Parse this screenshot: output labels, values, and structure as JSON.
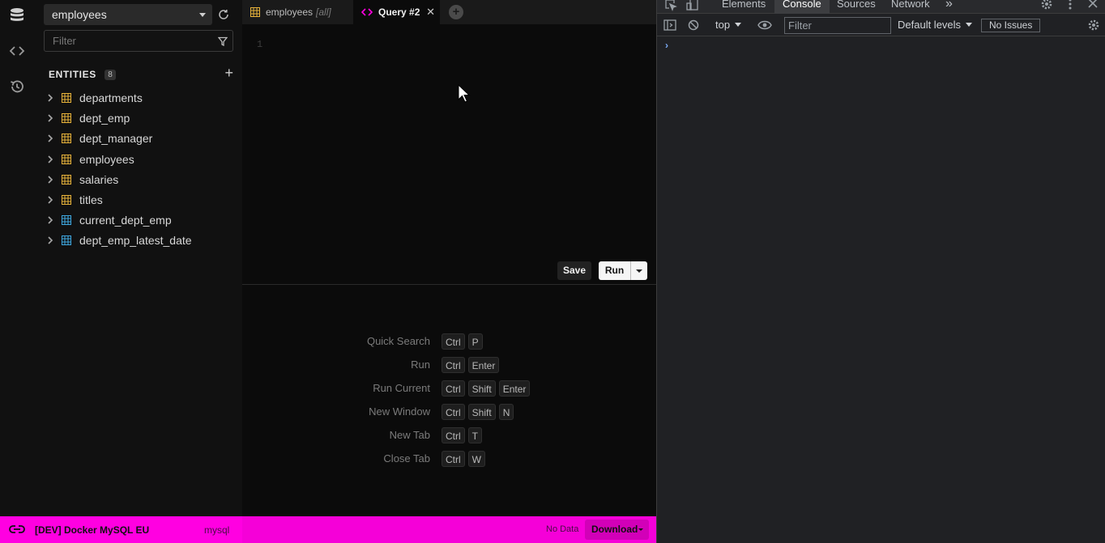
{
  "sidebar": {
    "database": "employees",
    "filter_placeholder": "Filter",
    "entities_title": "ENTITIES",
    "entities_count": "8",
    "entities": [
      {
        "name": "departments",
        "kind": "table"
      },
      {
        "name": "dept_emp",
        "kind": "table"
      },
      {
        "name": "dept_manager",
        "kind": "table"
      },
      {
        "name": "employees",
        "kind": "table"
      },
      {
        "name": "salaries",
        "kind": "table"
      },
      {
        "name": "titles",
        "kind": "table"
      },
      {
        "name": "current_dept_emp",
        "kind": "view"
      },
      {
        "name": "dept_emp_latest_date",
        "kind": "view"
      }
    ]
  },
  "tabs": [
    {
      "label": "employees",
      "tag": "[all]"
    },
    {
      "label": "Query #2",
      "close": "✕"
    }
  ],
  "editor": {
    "line_number": "1",
    "save_label": "Save",
    "run_label": "Run"
  },
  "shortcuts": [
    {
      "label": "Quick Search",
      "keys": [
        "Ctrl",
        "P"
      ]
    },
    {
      "label": "Run",
      "keys": [
        "Ctrl",
        "Enter"
      ]
    },
    {
      "label": "Run Current",
      "keys": [
        "Ctrl",
        "Shift",
        "Enter"
      ]
    },
    {
      "label": "New Window",
      "keys": [
        "Ctrl",
        "Shift",
        "N"
      ]
    },
    {
      "label": "New Tab",
      "keys": [
        "Ctrl",
        "T"
      ]
    },
    {
      "label": "Close Tab",
      "keys": [
        "Ctrl",
        "W"
      ]
    }
  ],
  "statusbar": {
    "connection": "[DEV] Docker MySQL EU",
    "driver": "mysql",
    "no_data": "No Data",
    "download_label": "Download"
  },
  "devtools": {
    "tabs": [
      "Elements",
      "Console",
      "Sources",
      "Network"
    ],
    "active_tab": "Console",
    "more": "»",
    "context": "top",
    "filter_placeholder": "Filter",
    "levels": "Default levels",
    "issues": "No Issues",
    "prompt": "›"
  },
  "colors": {
    "accent": "#ff00e1",
    "table_icon": "#e8b33a",
    "view_icon": "#3ea8e0"
  }
}
